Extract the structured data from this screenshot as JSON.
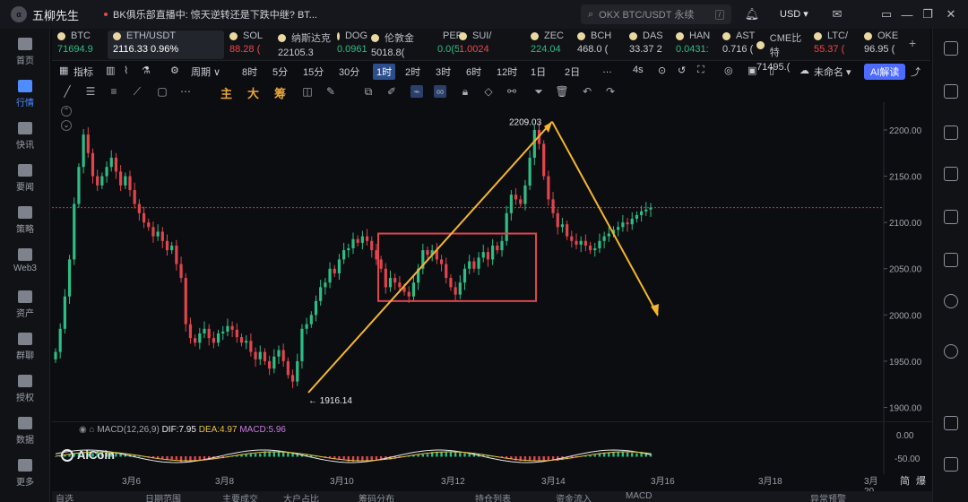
{
  "app": {
    "name": "五柳先生",
    "ticker_text": "BK俱乐部直播中: 惊天逆转还是下跌中继? BT...",
    "search_placeholder": "OKX BTC/USDT 永续",
    "search_key": "/",
    "currency": "USD"
  },
  "sidebar": [
    {
      "label": "首页"
    },
    {
      "label": "行情"
    },
    {
      "label": "快讯"
    },
    {
      "label": "要闻"
    },
    {
      "label": "策略"
    },
    {
      "label": "Web3"
    },
    {
      "label": "资产"
    },
    {
      "label": "群聊"
    },
    {
      "label": "授权"
    },
    {
      "label": "数据"
    },
    {
      "label": "更多"
    }
  ],
  "tickers": [
    {
      "name": "BTC",
      "price": "71694.9",
      "color": "#2ebd85"
    },
    {
      "name": "ETH/USDT",
      "price": "2116.33  0.96%",
      "color": "#ffffff"
    },
    {
      "name": "SOL",
      "price": "88.28 (",
      "color": "#f0464d"
    },
    {
      "name": "纳斯达克",
      "price": "22105.3",
      "color": "#c8ccd4"
    },
    {
      "name": "DOG",
      "price": "0.0961(",
      "color": "#2ebd85"
    },
    {
      "name": "伦敦金",
      "price": "5018.8(",
      "color": "#c8ccd4"
    },
    {
      "name": "PEP",
      "price": "0.0(5)3",
      "color": "#2ebd85"
    },
    {
      "name": "SUI/",
      "price": "1.0024",
      "color": "#f0464d"
    },
    {
      "name": "ZEC",
      "price": "224.04",
      "color": "#2ebd85"
    },
    {
      "name": "BCH",
      "price": "468.0 (",
      "color": "#c8ccd4"
    },
    {
      "name": "DAS",
      "price": "33.37 2",
      "color": "#c8ccd4"
    },
    {
      "name": "HAN",
      "price": "0.0431:",
      "color": "#2ebd85"
    },
    {
      "name": "AST",
      "price": "0.716 (",
      "color": "#c8ccd4"
    },
    {
      "name": "CME比特",
      "price": "71495.(",
      "color": "#c8ccd4"
    },
    {
      "name": "LTC/",
      "price": "55.37 (",
      "color": "#f0464d"
    },
    {
      "name": "OKE",
      "price": "96.95 (",
      "color": "#c8ccd4"
    }
  ],
  "toolbar": {
    "indicator": "指标",
    "period": "周期",
    "intervals": [
      "8时",
      "5分",
      "15分",
      "30分",
      "1时",
      "2时",
      "3时",
      "6时",
      "12时",
      "1日",
      "2日"
    ],
    "selected_interval": "1时",
    "sub4s": "4s",
    "unnamed": "未命名",
    "ai": "AI解读"
  },
  "drawtools": {
    "zhu": "主",
    "da": "大",
    "chou": "筹"
  },
  "chart_data": {
    "type": "candlestick",
    "title": "ETH/USDT",
    "y_ticks": [
      "2200.00",
      "2150.00",
      "2100.00",
      "2050.00",
      "2000.00",
      "1950.00",
      "1900.00"
    ],
    "x_ticks": [
      "3月6",
      "3月8",
      "3月10",
      "3月12",
      "3月14",
      "3月16",
      "3月18",
      "3月20"
    ],
    "annotations": {
      "high": "2209.03",
      "low": "← 1916.14"
    },
    "close": [
      1960,
      1985,
      2020,
      2060,
      2120,
      2160,
      2195,
      2175,
      2150,
      2140,
      2150,
      2160,
      2170,
      2155,
      2140,
      2150,
      2135,
      2120,
      2110,
      2100,
      2095,
      2085,
      2090,
      2080,
      2070,
      2075,
      2055,
      2040,
      1990,
      1975,
      1970,
      1980,
      1985,
      1975,
      1970,
      1980,
      1982,
      1988,
      1984,
      1976,
      1970,
      1972,
      1960,
      1952,
      1960,
      1950,
      1942,
      1955,
      1962,
      1950,
      1935,
      1928,
      1950,
      1985,
      1990,
      2000,
      2015,
      2030,
      2035,
      2050,
      2045,
      2060,
      2070,
      2072,
      2082,
      2078,
      2085,
      2080,
      2070,
      2060,
      2050,
      2030,
      2040,
      2035,
      2030,
      2025,
      2020,
      2035,
      2050,
      2070,
      2065,
      2070,
      2060,
      2055,
      2040,
      2030,
      2022,
      2035,
      2050,
      2058,
      2050,
      2062,
      2068,
      2060,
      2075,
      2070,
      2080,
      2110,
      2130,
      2125,
      2120,
      2140,
      2170,
      2200,
      2185,
      2150,
      2125,
      2110,
      2095,
      2098,
      2085,
      2080,
      2076,
      2080,
      2075,
      2070,
      2072,
      2080,
      2085,
      2088,
      2092,
      2095,
      2100,
      2098,
      2104,
      2108,
      2112,
      2114,
      2116
    ],
    "macd": {
      "params": "MACD(12,26,9)",
      "dif": "DIF:7.95",
      "dea": "DEA:4.97",
      "macd": "MACD:5.96"
    },
    "macd_axis": [
      "0.00",
      "-50.00"
    ]
  },
  "watermark": "AiCoin",
  "bottom": [
    "自选",
    "日期范围",
    "主要成交",
    "大户占比",
    "筹码分布",
    "持仓列表",
    "资金流入",
    "MACD",
    "异常预警",
    "简",
    "爆"
  ]
}
